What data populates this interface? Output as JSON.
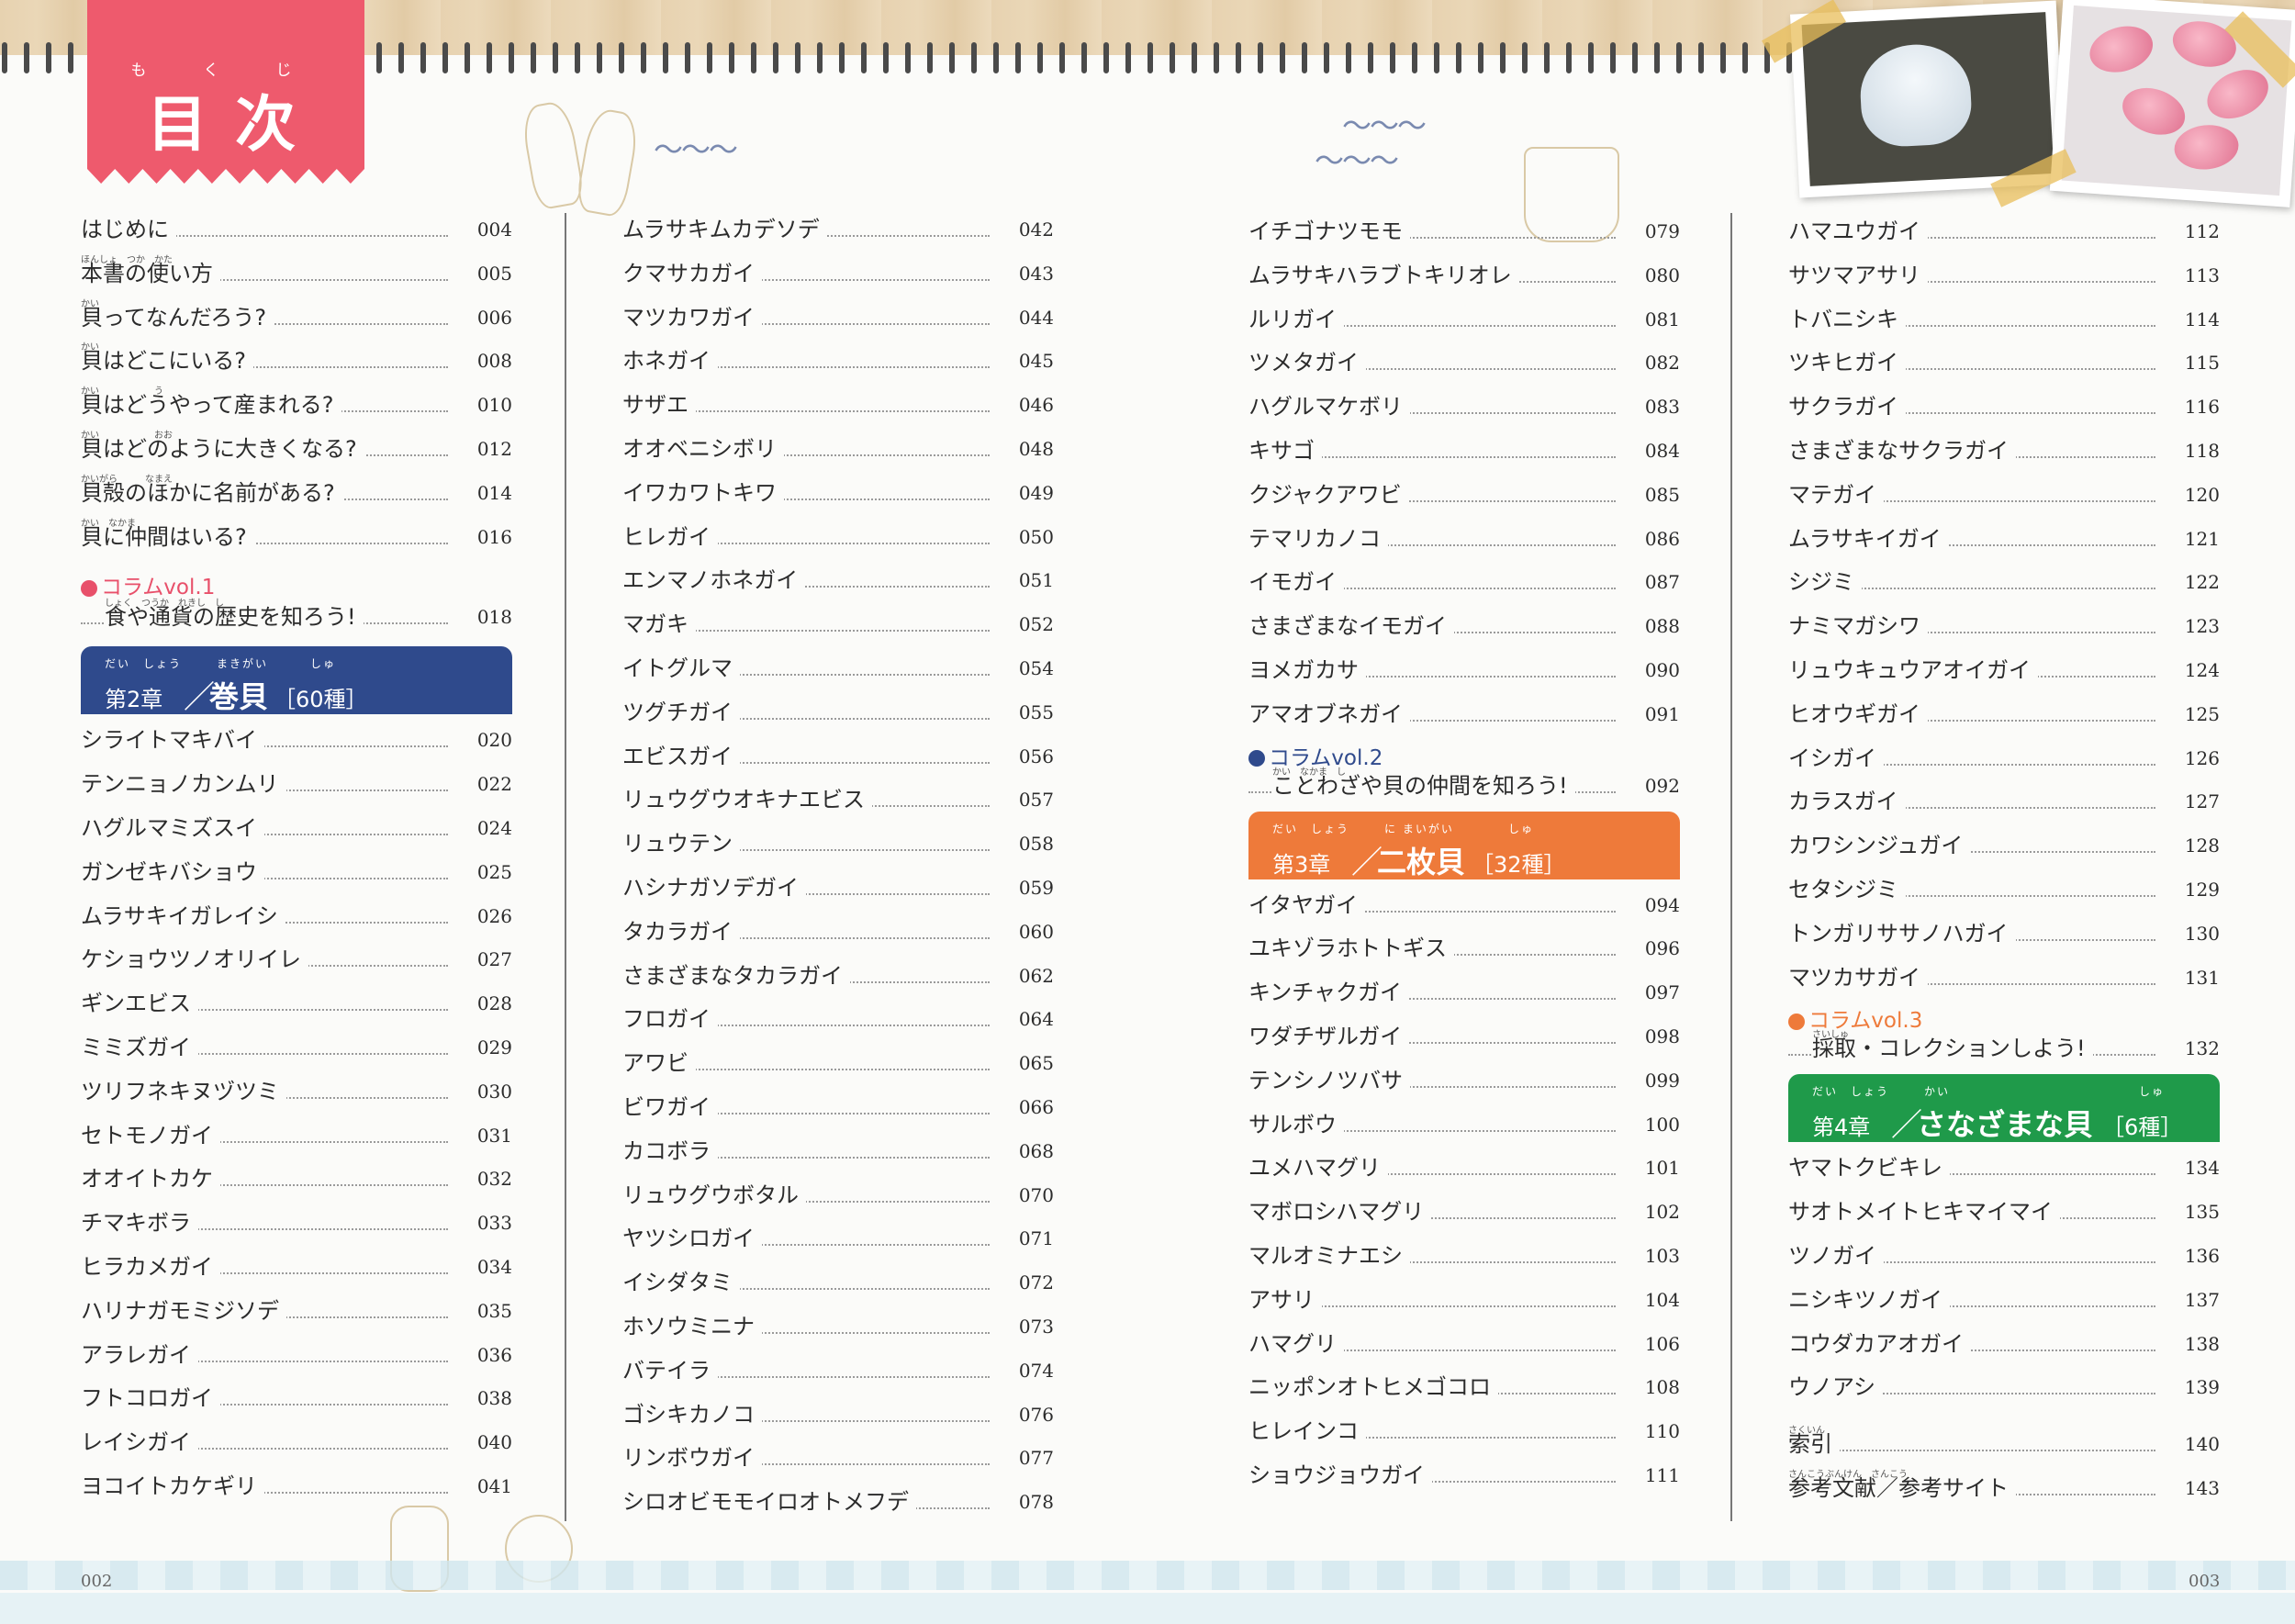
{
  "title": {
    "ruby": "もくじ",
    "text": "目次"
  },
  "page_left": "002",
  "page_right": "003",
  "col1": {
    "intro": [
      {
        "label": "はじめに",
        "page": "004"
      },
      {
        "label": "本書の使い方",
        "page": "005",
        "ruby": "ほんしょ　つか　かた"
      },
      {
        "label": "貝ってなんだろう?",
        "page": "006",
        "ruby": "かい"
      },
      {
        "label": "貝はどこにいる?",
        "page": "008",
        "ruby": "かい"
      },
      {
        "label": "貝はどうやって産まれる?",
        "page": "010",
        "ruby": "かい　　　　　　う"
      },
      {
        "label": "貝はどのように大きくなる?",
        "page": "012",
        "ruby": "かい　　　　　　おお"
      },
      {
        "label": "貝殻のほかに名前がある?",
        "page": "014",
        "ruby": "かいがら　　　なまえ"
      },
      {
        "label": "貝に仲間はいる?",
        "page": "016",
        "ruby": "かい　なかま"
      }
    ],
    "column_heading": "●コラムvol.1",
    "column_entry": {
      "label": "食や通貨の歴史を知ろう!",
      "page": "018",
      "ruby": "しょく　つうか　れきし　し"
    },
    "chapter": {
      "ruby1": "だい　しょう",
      "ruby2": "まきがい",
      "ruby3": "しゅ",
      "no": "第2章",
      "sep": "／",
      "name": "巻貝",
      "count": "［60種］"
    },
    "items": [
      {
        "label": "シライトマキバイ",
        "page": "020"
      },
      {
        "label": "テンニョノカンムリ",
        "page": "022"
      },
      {
        "label": "ハグルマミズスイ",
        "page": "024"
      },
      {
        "label": "ガンゼキバショウ",
        "page": "025"
      },
      {
        "label": "ムラサキイガレイシ",
        "page": "026"
      },
      {
        "label": "ケショウツノオリイレ",
        "page": "027"
      },
      {
        "label": "ギンエビス",
        "page": "028"
      },
      {
        "label": "ミミズガイ",
        "page": "029"
      },
      {
        "label": "ツリフネキヌヅツミ",
        "page": "030"
      },
      {
        "label": "セトモノガイ",
        "page": "031"
      },
      {
        "label": "オオイトカケ",
        "page": "032"
      },
      {
        "label": "チマキボラ",
        "page": "033"
      },
      {
        "label": "ヒラカメガイ",
        "page": "034"
      },
      {
        "label": "ハリナガモミジソデ",
        "page": "035"
      },
      {
        "label": "アラレガイ",
        "page": "036"
      },
      {
        "label": "フトコロガイ",
        "page": "038"
      },
      {
        "label": "レイシガイ",
        "page": "040"
      },
      {
        "label": "ヨコイトカケギリ",
        "page": "041"
      }
    ]
  },
  "col2": {
    "items": [
      {
        "label": "ムラサキムカデソデ",
        "page": "042"
      },
      {
        "label": "クマサカガイ",
        "page": "043"
      },
      {
        "label": "マツカワガイ",
        "page": "044"
      },
      {
        "label": "ホネガイ",
        "page": "045"
      },
      {
        "label": "サザエ",
        "page": "046"
      },
      {
        "label": "オオベニシボリ",
        "page": "048"
      },
      {
        "label": "イワカワトキワ",
        "page": "049"
      },
      {
        "label": "ヒレガイ",
        "page": "050"
      },
      {
        "label": "エンマノホネガイ",
        "page": "051"
      },
      {
        "label": "マガキ",
        "page": "052"
      },
      {
        "label": "イトグルマ",
        "page": "054"
      },
      {
        "label": "ツグチガイ",
        "page": "055"
      },
      {
        "label": "エビスガイ",
        "page": "056"
      },
      {
        "label": "リュウグウオキナエビス",
        "page": "057"
      },
      {
        "label": "リュウテン",
        "page": "058"
      },
      {
        "label": "ハシナガソデガイ",
        "page": "059"
      },
      {
        "label": "タカラガイ",
        "page": "060"
      },
      {
        "label": "さまざまなタカラガイ",
        "page": "062"
      },
      {
        "label": "フロガイ",
        "page": "064"
      },
      {
        "label": "アワビ",
        "page": "065"
      },
      {
        "label": "ビワガイ",
        "page": "066"
      },
      {
        "label": "カコボラ",
        "page": "068"
      },
      {
        "label": "リュウグウボタル",
        "page": "070"
      },
      {
        "label": "ヤツシロガイ",
        "page": "071"
      },
      {
        "label": "イシダタミ",
        "page": "072"
      },
      {
        "label": "ホソウミニナ",
        "page": "073"
      },
      {
        "label": "バテイラ",
        "page": "074"
      },
      {
        "label": "ゴシキカノコ",
        "page": "076"
      },
      {
        "label": "リンボウガイ",
        "page": "077"
      },
      {
        "label": "シロオビモモイロオトメフデ",
        "page": "078"
      }
    ]
  },
  "col3": {
    "items": [
      {
        "label": "イチゴナツモモ",
        "page": "079"
      },
      {
        "label": "ムラサキハラブトキリオレ",
        "page": "080"
      },
      {
        "label": "ルリガイ",
        "page": "081"
      },
      {
        "label": "ツメタガイ",
        "page": "082"
      },
      {
        "label": "ハグルマケボリ",
        "page": "083"
      },
      {
        "label": "キサゴ",
        "page": "084"
      },
      {
        "label": "クジャクアワビ",
        "page": "085"
      },
      {
        "label": "テマリカノコ",
        "page": "086"
      },
      {
        "label": "イモガイ",
        "page": "087"
      },
      {
        "label": "さまざまなイモガイ",
        "page": "088"
      },
      {
        "label": "ヨメガカサ",
        "page": "090"
      },
      {
        "label": "アマオブネガイ",
        "page": "091"
      }
    ],
    "column_heading": "●コラムvol.2",
    "column_entry": {
      "label": "ことわざや貝の仲間を知ろう!",
      "page": "092",
      "ruby": "かい　なかま　し"
    },
    "chapter": {
      "ruby1": "だい　しょう",
      "ruby2": "に まいがい",
      "ruby3": "しゅ",
      "no": "第3章",
      "sep": "／",
      "name": "二枚貝",
      "count": "［32種］"
    },
    "items2": [
      {
        "label": "イタヤガイ",
        "page": "094"
      },
      {
        "label": "ユキゾラホトトギス",
        "page": "096"
      },
      {
        "label": "キンチャクガイ",
        "page": "097"
      },
      {
        "label": "ワダチザルガイ",
        "page": "098"
      },
      {
        "label": "テンシノツバサ",
        "page": "099"
      },
      {
        "label": "サルボウ",
        "page": "100"
      },
      {
        "label": "ユメハマグリ",
        "page": "101"
      },
      {
        "label": "マボロシハマグリ",
        "page": "102"
      },
      {
        "label": "マルオミナエシ",
        "page": "103"
      },
      {
        "label": "アサリ",
        "page": "104"
      },
      {
        "label": "ハマグリ",
        "page": "106"
      },
      {
        "label": "ニッポンオトヒメゴコロ",
        "page": "108"
      },
      {
        "label": "ヒレインコ",
        "page": "110"
      },
      {
        "label": "ショウジョウガイ",
        "page": "111"
      }
    ]
  },
  "col4": {
    "items": [
      {
        "label": "ハマユウガイ",
        "page": "112"
      },
      {
        "label": "サツマアサリ",
        "page": "113"
      },
      {
        "label": "トバニシキ",
        "page": "114"
      },
      {
        "label": "ツキヒガイ",
        "page": "115"
      },
      {
        "label": "サクラガイ",
        "page": "116"
      },
      {
        "label": "さまざまなサクラガイ",
        "page": "118"
      },
      {
        "label": "マテガイ",
        "page": "120"
      },
      {
        "label": "ムラサキイガイ",
        "page": "121"
      },
      {
        "label": "シジミ",
        "page": "122"
      },
      {
        "label": "ナミマガシワ",
        "page": "123"
      },
      {
        "label": "リュウキュウアオイガイ",
        "page": "124"
      },
      {
        "label": "ヒオウギガイ",
        "page": "125"
      },
      {
        "label": "イシガイ",
        "page": "126"
      },
      {
        "label": "カラスガイ",
        "page": "127"
      },
      {
        "label": "カワシンジュガイ",
        "page": "128"
      },
      {
        "label": "セタシジミ",
        "page": "129"
      },
      {
        "label": "トンガリササノハガイ",
        "page": "130"
      },
      {
        "label": "マツカサガイ",
        "page": "131"
      }
    ],
    "column_heading": "●コラムvol.3",
    "column_entry": {
      "label": "採取・コレクションしよう!",
      "page": "132",
      "ruby": "さいしゅ"
    },
    "chapter": {
      "ruby1": "だい　しょう",
      "ruby2": "かい",
      "ruby3": "しゅ",
      "no": "第4章",
      "sep": "／",
      "name": "さなざまな貝",
      "count": "［6種］"
    },
    "items2": [
      {
        "label": "ヤマトクビキレ",
        "page": "134"
      },
      {
        "label": "サオトメイトヒキマイマイ",
        "page": "135"
      },
      {
        "label": "ツノガイ",
        "page": "136"
      },
      {
        "label": "ニシキツノガイ",
        "page": "137"
      },
      {
        "label": "コウダカアオガイ",
        "page": "138"
      },
      {
        "label": "ウノアシ",
        "page": "139"
      }
    ],
    "tail": [
      {
        "label": "索引",
        "page": "140",
        "ruby": "さくいん"
      },
      {
        "label": "参考文献／参考サイト",
        "page": "143",
        "ruby": "さんこうぶんけん　さんこう"
      }
    ]
  },
  "colors": {
    "title_tab": "#ee5a6d",
    "chapter2": "#2f4a8c",
    "chapter3": "#ee7a3a",
    "chapter4": "#1f9a4a",
    "column1_dot": "#e8506a",
    "column2_dot": "#2f4a8c",
    "column3_dot": "#ee7a3a"
  }
}
